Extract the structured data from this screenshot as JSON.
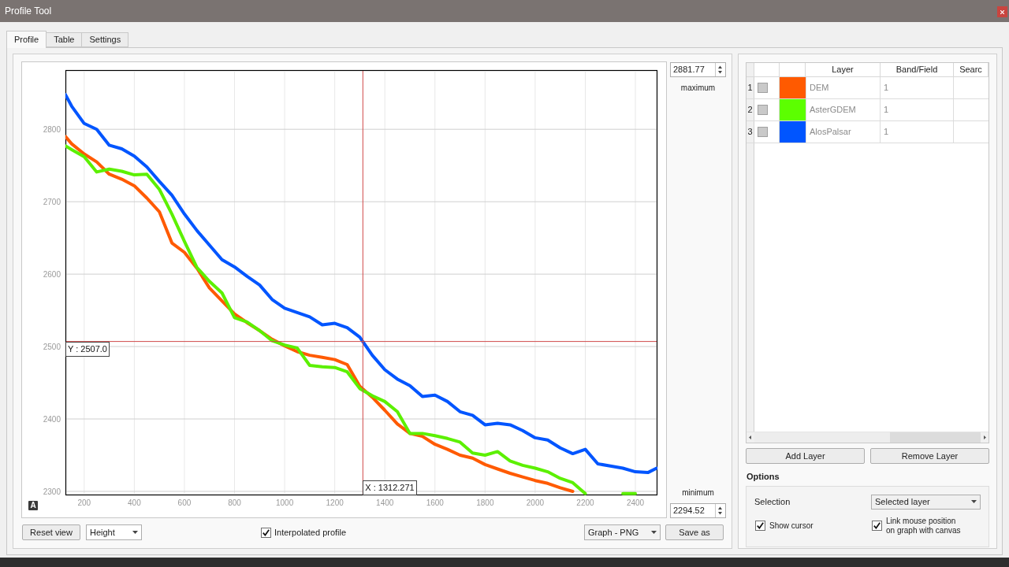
{
  "window": {
    "title": "Profile Tool"
  },
  "tabs": [
    {
      "label": "Profile",
      "selected": true
    },
    {
      "label": "Table",
      "selected": false
    },
    {
      "label": "Settings",
      "selected": false
    }
  ],
  "plot": {
    "autoscale_button": "A",
    "chart_data": {
      "type": "line",
      "x": [
        125,
        150,
        200,
        250,
        300,
        350,
        400,
        450,
        500,
        550,
        600,
        650,
        700,
        750,
        800,
        850,
        900,
        950,
        1000,
        1050,
        1100,
        1150,
        1200,
        1250,
        1300,
        1350,
        1400,
        1450,
        1500,
        1550,
        1600,
        1650,
        1700,
        1750,
        1800,
        1850,
        1900,
        1950,
        2000,
        2050,
        2100,
        2150,
        2200,
        2250,
        2300,
        2350,
        2400,
        2450,
        2485
      ],
      "series": [
        {
          "color": "#ff5a00",
          "values": [
            2790,
            2780,
            2766,
            2755,
            2738,
            2731,
            2722,
            2705,
            2686,
            2643,
            2630,
            2608,
            2581,
            2563,
            2545,
            2533,
            2522,
            2510,
            2501,
            2493,
            2488,
            2485,
            2482,
            2475,
            2445,
            2430,
            2412,
            2393,
            2380,
            2376,
            2365,
            2358,
            2350,
            2346,
            2337,
            2331,
            2325,
            2320,
            2315,
            2311,
            2305,
            2300,
            null,
            null,
            null,
            null,
            null,
            null,
            null
          ]
        },
        {
          "color": "#5cf000",
          "values": [
            2777,
            2772,
            2762,
            2741,
            2745,
            2742,
            2737,
            2738,
            2717,
            2683,
            2645,
            2609,
            2590,
            2574,
            2540,
            2534,
            2522,
            2508,
            2502,
            2498,
            2474,
            2472,
            2471,
            2465,
            2442,
            2432,
            2424,
            2410,
            2380,
            2380,
            2377,
            2373,
            2368,
            2353,
            2350,
            2355,
            2342,
            2336,
            2332,
            2327,
            2318,
            2312,
            2297,
            null,
            null,
            2297,
            2297,
            null,
            null
          ]
        },
        {
          "color": "#0055ff",
          "values": [
            2848,
            2832,
            2808,
            2800,
            2778,
            2773,
            2763,
            2748,
            2728,
            2709,
            2683,
            2660,
            2640,
            2620,
            2610,
            2597,
            2585,
            2565,
            2553,
            2547,
            2541,
            2530,
            2532,
            2526,
            2513,
            2488,
            2468,
            2455,
            2446,
            2431,
            2433,
            2424,
            2410,
            2405,
            2392,
            2394,
            2392,
            2384,
            2374,
            2371,
            2360,
            2352,
            2358,
            2338,
            2335,
            2332,
            2327,
            2326,
            2332
          ]
        }
      ],
      "xlim": [
        125,
        2488
      ],
      "ylim": [
        2294.52,
        2881.77
      ],
      "xticks": [
        200,
        400,
        600,
        800,
        1000,
        1200,
        1400,
        1600,
        1800,
        2000,
        2200,
        2400
      ],
      "yticks": [
        2300,
        2400,
        2500,
        2600,
        2700,
        2800
      ],
      "grid": true,
      "ref_lines": [
        {
          "axis": "x",
          "value": 1312.271,
          "label": "X : 1312.271"
        },
        {
          "axis": "y",
          "value": 2507.0,
          "label": "Y : 2507.0"
        }
      ]
    }
  },
  "y_range": {
    "maximum": {
      "value": "2881.77",
      "label": "maximum"
    },
    "minimum": {
      "label": "minimum",
      "value": "2294.52"
    }
  },
  "controls": {
    "reset_button": "Reset view",
    "mode_combo": "Height",
    "interpolated": {
      "label": "Interpolated profile",
      "checked": true
    },
    "export_combo": "Graph - PNG",
    "save_button": "Save as"
  },
  "layers_table": {
    "columns": [
      "Layer",
      "Band/Field",
      "Searc"
    ],
    "rows": [
      {
        "number": "1",
        "checked": false,
        "color": "#ff5a00",
        "layer": "DEM",
        "band": "1"
      },
      {
        "number": "2",
        "checked": false,
        "color": "#5cff00",
        "layer": "AsterGDEM",
        "band": "1"
      },
      {
        "number": "3",
        "checked": false,
        "color": "#0055ff",
        "layer": "AlosPalsar",
        "band": "1"
      }
    ]
  },
  "layer_buttons": [
    "Add Layer",
    "Remove Layer"
  ],
  "options": {
    "title": "Options",
    "selection_label": "Selection",
    "selection_value": "Selected layer",
    "checkboxes": [
      {
        "label": "Show cursor",
        "checked": true
      },
      {
        "label": "Link mouse position\non graph with canvas",
        "checked": true
      }
    ]
  }
}
